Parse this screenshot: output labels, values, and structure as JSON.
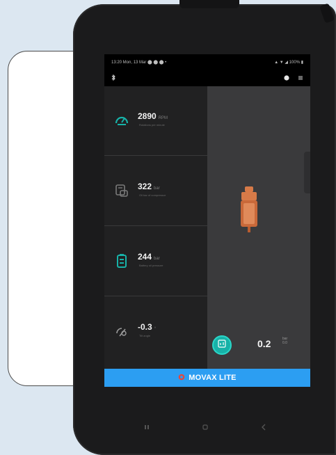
{
  "status_bar": {
    "left": "13:20  Mon, 13 Mar  ⬤ ⬤ ⬤  •",
    "right": "▲ ▼ ◢ 100% ▮"
  },
  "tiles": [
    {
      "icon": "speedometer-icon",
      "value": "2890",
      "unit": "RPM",
      "caption": "Rotations per minute"
    },
    {
      "icon": "compressor-icon",
      "value": "322",
      "unit": "bar",
      "caption": "Oil bar of compressor"
    },
    {
      "icon": "battery-icon",
      "value": "244",
      "unit": "bar",
      "caption": "Battery oil pressure"
    },
    {
      "icon": "tilt-icon",
      "value": "-0.3",
      "unit": "°",
      "caption": "Tilt angle"
    }
  ],
  "pressure": {
    "value": "0.2",
    "unit_top": "bar",
    "unit_bottom": "0.0"
  },
  "brand": {
    "name": "MOVAX LITE"
  },
  "colors": {
    "accent_teal": "#17b2a8",
    "brand_blue": "#2c9ef2",
    "device_orange": "#d67a48"
  }
}
